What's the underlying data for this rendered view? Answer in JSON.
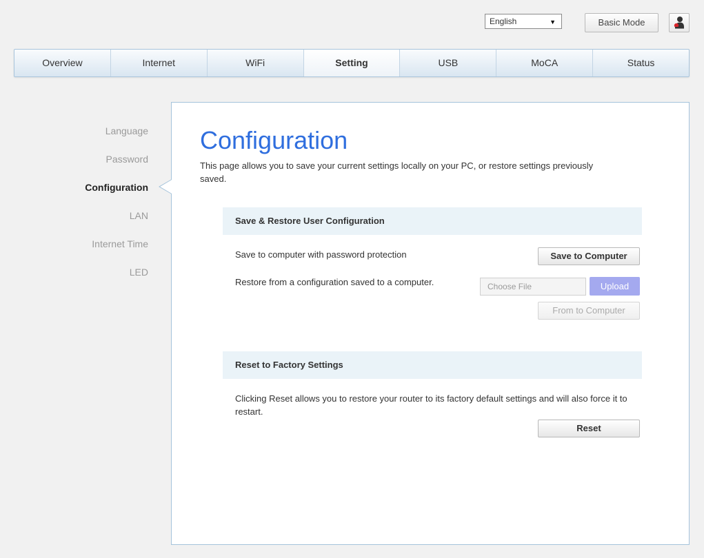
{
  "topbar": {
    "language_selected": "English",
    "basic_mode_label": "Basic Mode"
  },
  "nav": {
    "tabs": [
      {
        "label": "Overview"
      },
      {
        "label": "Internet"
      },
      {
        "label": "WiFi"
      },
      {
        "label": "Setting"
      },
      {
        "label": "USB"
      },
      {
        "label": "MoCA"
      },
      {
        "label": "Status"
      }
    ],
    "active_tab": "Setting"
  },
  "sidebar": {
    "items": [
      {
        "label": "Language"
      },
      {
        "label": "Password"
      },
      {
        "label": "Configuration"
      },
      {
        "label": "LAN"
      },
      {
        "label": "Internet Time"
      },
      {
        "label": "LED"
      }
    ],
    "active_item": "Configuration"
  },
  "main": {
    "title": "Configuration",
    "description": "This page allows you to save your current settings locally on your PC, or restore settings previously saved.",
    "save_restore": {
      "header": "Save & Restore User Configuration",
      "save_label": "Save to computer with password protection",
      "save_button": "Save to Computer",
      "restore_label": "Restore from a configuration saved to a computer.",
      "file_placeholder": "Choose File",
      "upload_button": "Upload",
      "from_computer_button": "From to Computer"
    },
    "reset": {
      "header": "Reset to Factory Settings",
      "description": "Clicking Reset allows you to restore your router to its factory default settings and will also force it to restart.",
      "reset_button": "Reset"
    }
  },
  "colors": {
    "title_blue": "#2f6ede",
    "upload_button": "#a4a9ef",
    "section_header_bg": "#eaf3f8",
    "panel_border": "#a4c3db"
  },
  "icons": {
    "language_dropdown": "caret-down-icon",
    "user": "user-icon"
  }
}
